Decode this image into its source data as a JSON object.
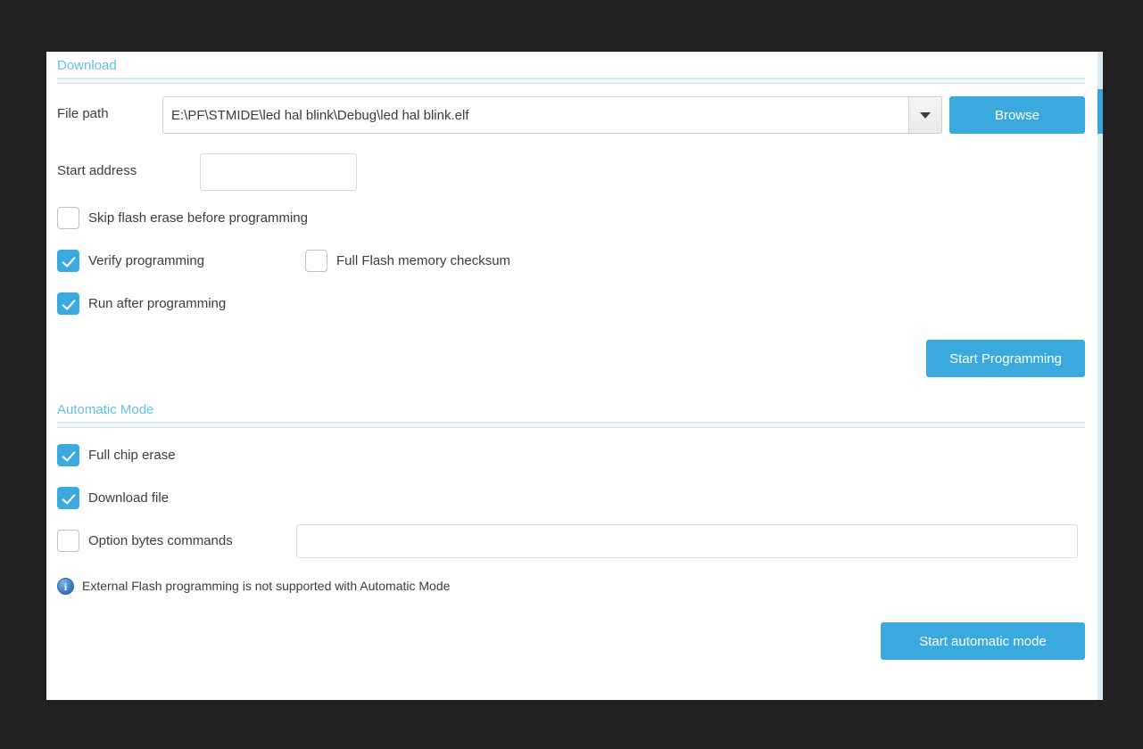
{
  "colors": {
    "app_background": "#212121",
    "panel_background": "#ffffff",
    "accent_blue": "#3aa9de",
    "section_title_blue": "#64c1e8",
    "scrollbar_track": "#d9ecf5",
    "scrollbar_thumb": "#3aa3d8",
    "text": "#3c3c3c"
  },
  "download_section": {
    "title": "Download",
    "file_path": {
      "label": "File path",
      "value": "E:\\PF\\STMIDE\\led hal blink\\Debug\\led hal blink.elf",
      "dropdown_icon": "chevron-down-icon"
    },
    "browse_button": "Browse",
    "start_address": {
      "label": "Start address",
      "value": "",
      "placeholder": ""
    },
    "options": [
      {
        "label": "Skip flash erase before programming",
        "checked": false
      },
      {
        "label": "Verify programming",
        "checked": true
      },
      {
        "label": "Full Flash memory checksum",
        "checked": false
      },
      {
        "label": "Run after programming",
        "checked": true
      }
    ],
    "start_programming_button": "Start Programming"
  },
  "automatic_mode_section": {
    "title": "Automatic Mode",
    "options": [
      {
        "label": "Full chip erase",
        "checked": true
      },
      {
        "label": "Download file",
        "checked": true
      },
      {
        "label": "Option bytes commands",
        "checked": false
      }
    ],
    "option_bytes_input": {
      "value": "",
      "placeholder": ""
    },
    "note": {
      "icon": "info-icon",
      "text": "External Flash programming is not supported with Automatic Mode"
    },
    "start_automatic_mode_button": "Start automatic mode"
  }
}
